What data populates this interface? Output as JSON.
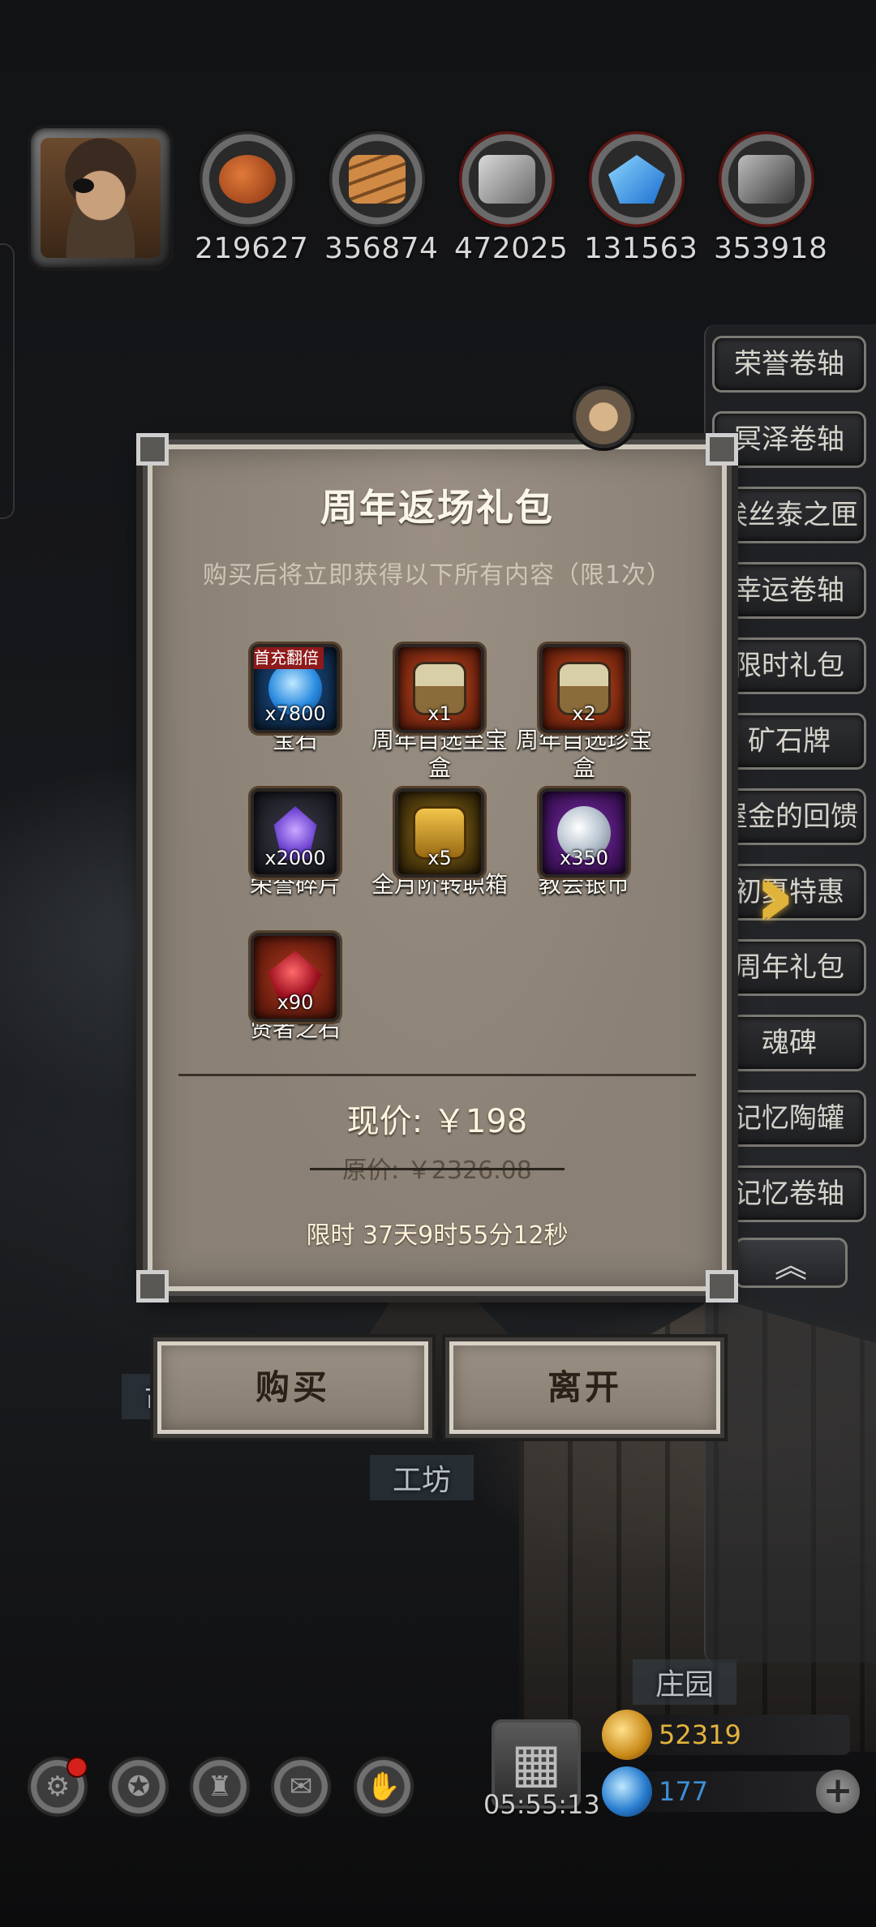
{
  "resources": [
    {
      "icon": "meat-icon",
      "value": "219627",
      "ring": "plain"
    },
    {
      "icon": "wood-planks-icon",
      "value": "356874",
      "ring": "plain"
    },
    {
      "icon": "iron-ingot-icon",
      "value": "472025",
      "ring": "red"
    },
    {
      "icon": "crystal-icon",
      "value": "131563",
      "ring": "red"
    },
    {
      "icon": "steel-bar-icon",
      "value": "353918",
      "ring": "red"
    }
  ],
  "side_menu": {
    "items": [
      "荣誉卷轴",
      "冥泽卷轴",
      "埃丝泰之匣",
      "幸运卷轴",
      "限时礼包",
      "矿石牌",
      "屋金的回馈",
      "初夏特惠",
      "周年礼包",
      "魂碑",
      "记忆陶罐",
      "记忆卷轴"
    ],
    "collapse_icon": "︽"
  },
  "map_labels": {
    "market": "市",
    "workshop": "工坊",
    "manor": "庄园"
  },
  "dialog": {
    "title": "周年返场礼包",
    "subtitle": "购买后将立即获得以下所有内容（限1次）",
    "items": [
      {
        "name": "宝石",
        "qty": "x7800",
        "badge": "首充翻倍",
        "icon": "gem-icon",
        "frame": "#0d3a6a"
      },
      {
        "name": "周年自选至宝盒",
        "qty": "x1",
        "badge": "",
        "icon": "treasure-chest-icon",
        "frame": "#8a2a14"
      },
      {
        "name": "周年自选珍宝盒",
        "qty": "x2",
        "badge": "",
        "icon": "treasure-chest-icon",
        "frame": "#8a2a14"
      },
      {
        "name": "荣誉碎片",
        "qty": "x2000",
        "badge": "",
        "icon": "honor-shard-icon",
        "frame": "#2a2b35"
      },
      {
        "name": "全月阶转职箱",
        "qty": "x5",
        "badge": "",
        "icon": "gold-chest-icon",
        "frame": "#6a5012"
      },
      {
        "name": "教会银币",
        "qty": "x350",
        "badge": "",
        "icon": "silver-coin-icon",
        "frame": "#4a1a6a"
      },
      {
        "name": "贤者之石",
        "qty": "x90",
        "badge": "",
        "icon": "sage-stone-icon",
        "frame": "#7a1e12"
      }
    ],
    "price_now": "现价: ￥198",
    "price_old": "原价: ￥2326.08",
    "limit": "限时 37天9时55分12秒"
  },
  "buttons": {
    "buy": "购买",
    "leave": "离开"
  },
  "bottom": {
    "icons": [
      "settings-gear-icon",
      "star-badge-icon",
      "castle-icon",
      "mail-icon",
      "handshake-icon"
    ],
    "gift_timer": "05:55:13",
    "gold": "52319",
    "gems": "177",
    "plus": "+"
  },
  "colors": {
    "gold_text": "#e3b33c",
    "gem_text": "#3f8ed4",
    "badge_red": "#8e1a1a",
    "highlight_chevron": "#e0b43a"
  }
}
